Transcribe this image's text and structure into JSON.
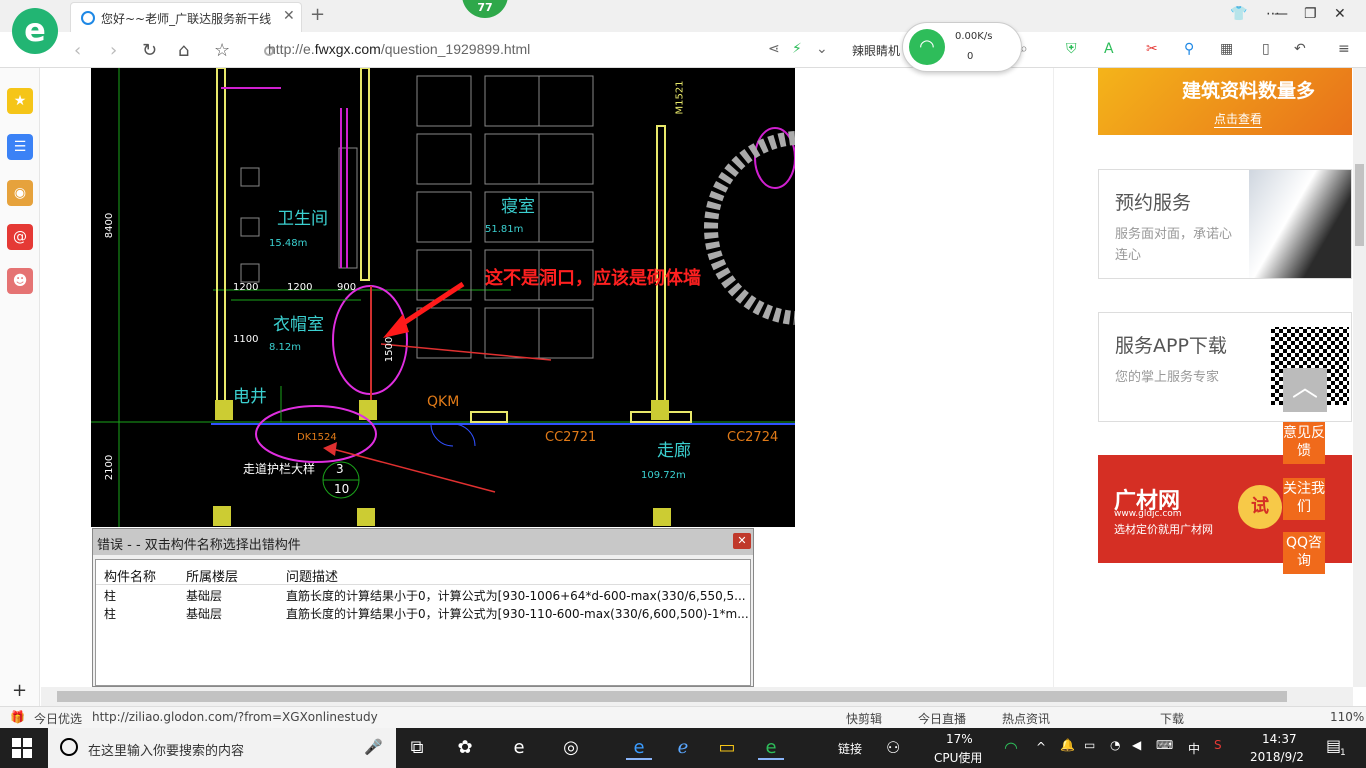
{
  "browser": {
    "logo_glyph": "e",
    "tab_title": "您好~~老师_广联达服务新干线",
    "tab_close": "✕",
    "new_tab": "+",
    "badge_count": "77",
    "url_host": "http://e.",
    "url_domain": "fwxgx.com",
    "url_path": "/question_1929899.html",
    "nav_text": "辣眼睛机",
    "network_speed": "0.00K/s",
    "network_count": "0"
  },
  "cad": {
    "annotation": "这不是洞口，应该是砌体墙",
    "rooms": [
      {
        "name": "卫生间",
        "area": "15.48m"
      },
      {
        "name": "寝室",
        "area": "51.81m"
      },
      {
        "name": "衣帽室",
        "area": "8.12m"
      },
      {
        "name": "电井",
        "area": ""
      },
      {
        "name": "走廊",
        "area": "109.72m"
      }
    ],
    "dims": [
      "1200",
      "1200",
      "900",
      "1100",
      "8400",
      "2100",
      "1500",
      "QKM",
      "CC2721",
      "CC2724",
      "DK1524",
      "M1521",
      "走道护栏大样",
      "3",
      "10"
    ]
  },
  "error_window": {
    "title": "错误 - - 双击构件名称选择出错构件",
    "close": "✕",
    "columns": [
      "构件名称",
      "所属楼层",
      "问题描述"
    ],
    "rows": [
      [
        "柱",
        "基础层",
        "直筋长度的计算结果小于0，计算公式为[930-1006+64*d-600-max(330/6,550,5..."
      ],
      [
        "柱",
        "基础层",
        "直筋长度的计算结果小于0，计算公式为[930-110-600-max(330/6,600,500)-1*m..."
      ]
    ]
  },
  "ads": {
    "ad1_title": "建筑资料数量多",
    "ad1_link": "点击查看",
    "ad2_title": "预约服务",
    "ad2_desc": "服务面对面，承诺心连心",
    "ad3_title": "服务APP下载",
    "ad3_desc": "您的掌上服务专家",
    "ad4_brand": "广材网",
    "ad4_url": "www.gldjc.com",
    "ad4_sub": "选材定价就用广材网",
    "ad4_try": "试",
    "feedback": [
      "意见反馈",
      "关注我们",
      "QQ咨询"
    ]
  },
  "statusbar": {
    "today": "今日优选",
    "link": "http://ziliao.glodon.com/?from=XGXonlinestudy",
    "items": [
      "快剪辑",
      "今日直播",
      "热点资讯",
      "下载"
    ],
    "zoom": "110%"
  },
  "taskbar": {
    "search_placeholder": "在这里输入你要搜索的内容",
    "link_label": "链接",
    "cpu_percent": "17%",
    "cpu_label": "CPU使用",
    "ime": "中",
    "time": "14:37",
    "date": "2018/9/2",
    "notifications": "1"
  }
}
